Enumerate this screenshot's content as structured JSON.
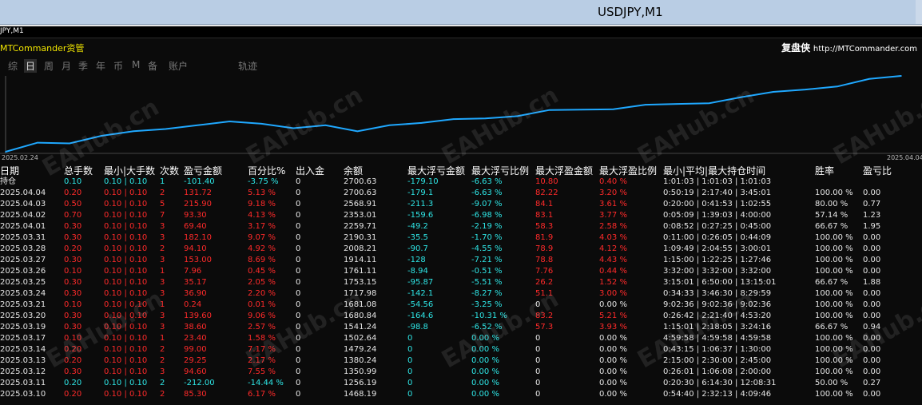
{
  "window": {
    "title": "USDJPY,M1"
  },
  "chart_header": {
    "symbol": "JPY,M1"
  },
  "panel": {
    "brand": "MTCommander资管",
    "credit_name": "复盘侠",
    "credit_url": "http://MTCommander.com",
    "tabs": [
      {
        "label": "综",
        "selected": false
      },
      {
        "label": "日",
        "selected": true
      },
      {
        "label": "周",
        "selected": false
      },
      {
        "label": "月",
        "selected": false
      },
      {
        "label": "季",
        "selected": false
      },
      {
        "label": "年",
        "selected": false
      },
      {
        "label": "币",
        "selected": false
      },
      {
        "label": "M",
        "selected": false
      },
      {
        "label": "备",
        "selected": false
      },
      {
        "label": "账户",
        "selected": false
      },
      {
        "label": "轨迹",
        "selected": false
      }
    ]
  },
  "colors": {
    "line": "#1fa8ff",
    "profit": "#ff2a2a",
    "loss": "#2ee6e6",
    "text": "#e6e6e6",
    "brand": "#f2e600"
  },
  "watermark": "EAHub.cn",
  "chart_data": {
    "type": "line",
    "title": "",
    "x_start_label": "2025.02.24",
    "x_end_label": "2025.04.04",
    "x": [
      "2025.02.24",
      "2025.02.25",
      "2025.02.26",
      "2025.02.27",
      "2025.02.28",
      "2025.03.03",
      "2025.03.04",
      "2025.03.05",
      "2025.03.06",
      "2025.03.07",
      "2025.03.10",
      "2025.03.11",
      "2025.03.12",
      "2025.03.13",
      "2025.03.14",
      "2025.03.17",
      "2025.03.19",
      "2025.03.20",
      "2025.03.21",
      "2025.03.24",
      "2025.03.25",
      "2025.03.26",
      "2025.03.27",
      "2025.03.28",
      "2025.03.31",
      "2025.04.01",
      "2025.04.02",
      "2025.04.03",
      "2025.04.04"
    ],
    "values": [
      1000,
      1120,
      1110,
      1210,
      1270,
      1300,
      1350,
      1400,
      1370,
      1310,
      1350,
      1270,
      1350,
      1380,
      1430,
      1440,
      1470,
      1550,
      1555,
      1560,
      1620,
      1630,
      1640,
      1720,
      1790,
      1820,
      1860,
      1960,
      2000
    ]
  },
  "table": {
    "headers": [
      "日期",
      "总手数",
      "最小|大手数",
      "次数",
      "盈亏金额",
      "百分比%",
      "出入金",
      "余额",
      "最大浮亏金额",
      "最大浮亏比例",
      "最大浮盈金额",
      "最大浮盈比例",
      "最小|平均|最大持仓时间",
      "胜率",
      "盈亏比"
    ],
    "hold": {
      "label": "持仓",
      "lots": "0.10",
      "minmax": "0.10 | 0.10",
      "count": "1",
      "pnl": "-101.40",
      "pct": "-3.75 %",
      "io": "0",
      "balance": "2700.63",
      "maxdd": "-179.10",
      "maxddpct": "-6.63 %",
      "maxfp": "10.80",
      "maxfppct": "0.40 %",
      "times": "1:01:03 | 1:01:03 | 1:01:03",
      "win": "",
      "rr": ""
    },
    "rows": [
      {
        "date": "2025.04.04",
        "lots": "0.20",
        "minmax": "0.10 | 0.10",
        "count": "2",
        "pnl": "131.72",
        "pct": "5.13 %",
        "io": "0",
        "balance": "2700.63",
        "maxdd": "-179.1",
        "maxddpct": "-6.63 %",
        "maxfp": "82.22",
        "maxfppct": "3.20 %",
        "times": "0:50:19 | 2:17:40 | 3:45:01",
        "win": "100.00 %",
        "rr": "0.00"
      },
      {
        "date": "2025.04.03",
        "lots": "0.50",
        "minmax": "0.10 | 0.10",
        "count": "5",
        "pnl": "215.90",
        "pct": "9.18 %",
        "io": "0",
        "balance": "2568.91",
        "maxdd": "-211.3",
        "maxddpct": "-9.07 %",
        "maxfp": "84.1",
        "maxfppct": "3.61 %",
        "times": "0:20:00 | 0:41:53 | 1:02:55",
        "win": "80.00 %",
        "rr": "0.77"
      },
      {
        "date": "2025.04.02",
        "lots": "0.70",
        "minmax": "0.10 | 0.10",
        "count": "7",
        "pnl": "93.30",
        "pct": "4.13 %",
        "io": "0",
        "balance": "2353.01",
        "maxdd": "-159.6",
        "maxddpct": "-6.98 %",
        "maxfp": "83.1",
        "maxfppct": "3.77 %",
        "times": "0:05:09 | 1:39:03 | 4:00:00",
        "win": "57.14 %",
        "rr": "1.23"
      },
      {
        "date": "2025.04.01",
        "lots": "0.30",
        "minmax": "0.10 | 0.10",
        "count": "3",
        "pnl": "69.40",
        "pct": "3.17 %",
        "io": "0",
        "balance": "2259.71",
        "maxdd": "-49.2",
        "maxddpct": "-2.19 %",
        "maxfp": "58.3",
        "maxfppct": "2.58 %",
        "times": "0:08:52 | 0:27:25 | 0:45:00",
        "win": "66.67 %",
        "rr": "1.95"
      },
      {
        "date": "2025.03.31",
        "lots": "0.30",
        "minmax": "0.10 | 0.10",
        "count": "3",
        "pnl": "182.10",
        "pct": "9.07 %",
        "io": "0",
        "balance": "2190.31",
        "maxdd": "-35.5",
        "maxddpct": "-1.70 %",
        "maxfp": "81.9",
        "maxfppct": "4.03 %",
        "times": "0:11:00 | 0:26:05 | 0:44:09",
        "win": "100.00 %",
        "rr": "0.00"
      },
      {
        "date": "2025.03.28",
        "lots": "0.20",
        "minmax": "0.10 | 0.10",
        "count": "2",
        "pnl": "94.10",
        "pct": "4.92 %",
        "io": "0",
        "balance": "2008.21",
        "maxdd": "-90.7",
        "maxddpct": "-4.55 %",
        "maxfp": "78.9",
        "maxfppct": "4.12 %",
        "times": "1:09:49 | 2:04:55 | 3:00:01",
        "win": "100.00 %",
        "rr": "0.00"
      },
      {
        "date": "2025.03.27",
        "lots": "0.30",
        "minmax": "0.10 | 0.10",
        "count": "3",
        "pnl": "153.00",
        "pct": "8.69 %",
        "io": "0",
        "balance": "1914.11",
        "maxdd": "-128",
        "maxddpct": "-7.21 %",
        "maxfp": "78.8",
        "maxfppct": "4.43 %",
        "times": "1:15:00 | 1:22:25 | 1:27:46",
        "win": "100.00 %",
        "rr": "0.00"
      },
      {
        "date": "2025.03.26",
        "lots": "0.10",
        "minmax": "0.10 | 0.10",
        "count": "1",
        "pnl": "7.96",
        "pct": "0.45 %",
        "io": "0",
        "balance": "1761.11",
        "maxdd": "-8.94",
        "maxddpct": "-0.51 %",
        "maxfp": "7.76",
        "maxfppct": "0.44 %",
        "times": "3:32:00 | 3:32:00 | 3:32:00",
        "win": "100.00 %",
        "rr": "0.00"
      },
      {
        "date": "2025.03.25",
        "lots": "0.30",
        "minmax": "0.10 | 0.10",
        "count": "3",
        "pnl": "35.17",
        "pct": "2.05 %",
        "io": "0",
        "balance": "1753.15",
        "maxdd": "-95.87",
        "maxddpct": "-5.51 %",
        "maxfp": "26.2",
        "maxfppct": "1.52 %",
        "times": "3:15:01 | 6:50:00 | 13:15:01",
        "win": "66.67 %",
        "rr": "1.88"
      },
      {
        "date": "2025.03.24",
        "lots": "0.30",
        "minmax": "0.10 | 0.10",
        "count": "3",
        "pnl": "36.90",
        "pct": "2.20 %",
        "io": "0",
        "balance": "1717.98",
        "maxdd": "-142.1",
        "maxddpct": "-8.27 %",
        "maxfp": "51.1",
        "maxfppct": "3.00 %",
        "times": "0:34:33 | 3:46:30 | 8:29:59",
        "win": "100.00 %",
        "rr": "0.00"
      },
      {
        "date": "2025.03.21",
        "lots": "0.10",
        "minmax": "0.10 | 0.10",
        "count": "1",
        "pnl": "0.24",
        "pct": "0.01 %",
        "io": "0",
        "balance": "1681.08",
        "maxdd": "-54.56",
        "maxddpct": "-3.25 %",
        "maxfp": "0",
        "maxfppct": "0.00 %",
        "times": "9:02:36 | 9:02:36 | 9:02:36",
        "win": "100.00 %",
        "rr": "0.00"
      },
      {
        "date": "2025.03.20",
        "lots": "0.30",
        "minmax": "0.10 | 0.10",
        "count": "3",
        "pnl": "139.60",
        "pct": "9.06 %",
        "io": "0",
        "balance": "1680.84",
        "maxdd": "-164.6",
        "maxddpct": "-10.31 %",
        "maxfp": "83.2",
        "maxfppct": "5.21 %",
        "times": "0:26:42 | 2:21:40 | 4:53:20",
        "win": "100.00 %",
        "rr": "0.00"
      },
      {
        "date": "2025.03.19",
        "lots": "0.30",
        "minmax": "0.10 | 0.10",
        "count": "3",
        "pnl": "38.60",
        "pct": "2.57 %",
        "io": "0",
        "balance": "1541.24",
        "maxdd": "-98.8",
        "maxddpct": "-6.52 %",
        "maxfp": "57.3",
        "maxfppct": "3.93 %",
        "times": "1:15:01 | 2:18:05 | 3:24:16",
        "win": "66.67 %",
        "rr": "0.94"
      },
      {
        "date": "2025.03.17",
        "lots": "0.10",
        "minmax": "0.10 | 0.10",
        "count": "1",
        "pnl": "23.40",
        "pct": "1.58 %",
        "io": "0",
        "balance": "1502.64",
        "maxdd": "0",
        "maxddpct": "0.00 %",
        "maxfp": "0",
        "maxfppct": "0.00 %",
        "times": "4:59:58 | 4:59:58 | 4:59:58",
        "win": "100.00 %",
        "rr": "0.00"
      },
      {
        "date": "2025.03.14",
        "lots": "0.20",
        "minmax": "0.10 | 0.10",
        "count": "2",
        "pnl": "99.00",
        "pct": "7.17 %",
        "io": "0",
        "balance": "1479.24",
        "maxdd": "0",
        "maxddpct": "0.00 %",
        "maxfp": "0",
        "maxfppct": "0.00 %",
        "times": "0:43:15 | 1:06:37 | 1:30:00",
        "win": "100.00 %",
        "rr": "0.00"
      },
      {
        "date": "2025.03.13",
        "lots": "0.20",
        "minmax": "0.10 | 0.10",
        "count": "2",
        "pnl": "29.25",
        "pct": "2.17 %",
        "io": "0",
        "balance": "1380.24",
        "maxdd": "0",
        "maxddpct": "0.00 %",
        "maxfp": "0",
        "maxfppct": "0.00 %",
        "times": "2:15:00 | 2:30:00 | 2:45:00",
        "win": "100.00 %",
        "rr": "0.00"
      },
      {
        "date": "2025.03.12",
        "lots": "0.30",
        "minmax": "0.10 | 0.10",
        "count": "3",
        "pnl": "94.60",
        "pct": "7.55 %",
        "io": "0",
        "balance": "1350.99",
        "maxdd": "0",
        "maxddpct": "0.00 %",
        "maxfp": "0",
        "maxfppct": "0.00 %",
        "times": "0:26:01 | 1:06:08 | 2:00:00",
        "win": "100.00 %",
        "rr": "0.00"
      },
      {
        "date": "2025.03.11",
        "lots": "0.20",
        "minmax": "0.10 | 0.10",
        "count": "2",
        "pnl": "-212.00",
        "pct": "-14.44 %",
        "io": "0",
        "balance": "1256.19",
        "maxdd": "0",
        "maxddpct": "0.00 %",
        "maxfp": "0",
        "maxfppct": "0.00 %",
        "times": "0:20:30 | 6:14:30 | 12:08:31",
        "win": "50.00 %",
        "rr": "0.27"
      },
      {
        "date": "2025.03.10",
        "lots": "0.20",
        "minmax": "0.10 | 0.10",
        "count": "2",
        "pnl": "85.30",
        "pct": "6.17 %",
        "io": "0",
        "balance": "1468.19",
        "maxdd": "0",
        "maxddpct": "0.00 %",
        "maxfp": "0",
        "maxfppct": "0.00 %",
        "times": "0:54:40 | 2:32:13 | 4:09:46",
        "win": "100.00 %",
        "rr": "0.00"
      }
    ]
  }
}
